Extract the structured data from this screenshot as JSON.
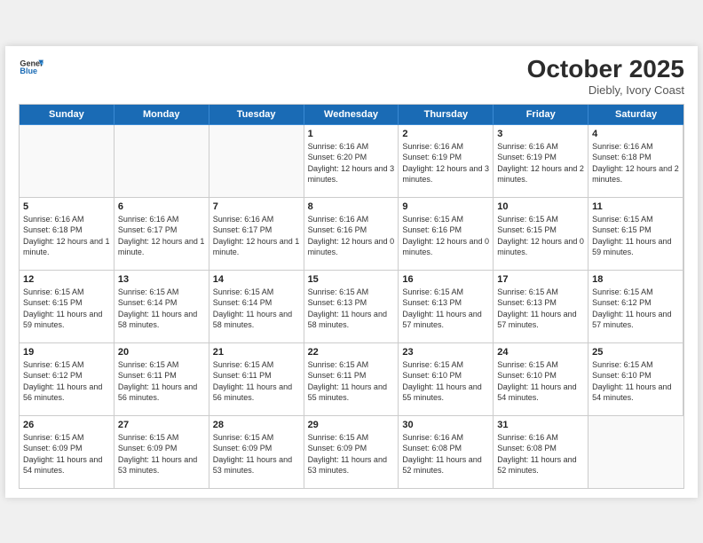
{
  "header": {
    "logo_line1": "General",
    "logo_line2": "Blue",
    "month": "October 2025",
    "location": "Diebly, Ivory Coast"
  },
  "weekdays": [
    "Sunday",
    "Monday",
    "Tuesday",
    "Wednesday",
    "Thursday",
    "Friday",
    "Saturday"
  ],
  "weeks": [
    [
      {
        "num": "",
        "info": ""
      },
      {
        "num": "",
        "info": ""
      },
      {
        "num": "",
        "info": ""
      },
      {
        "num": "1",
        "info": "Sunrise: 6:16 AM\nSunset: 6:20 PM\nDaylight: 12 hours and 3 minutes."
      },
      {
        "num": "2",
        "info": "Sunrise: 6:16 AM\nSunset: 6:19 PM\nDaylight: 12 hours and 3 minutes."
      },
      {
        "num": "3",
        "info": "Sunrise: 6:16 AM\nSunset: 6:19 PM\nDaylight: 12 hours and 2 minutes."
      },
      {
        "num": "4",
        "info": "Sunrise: 6:16 AM\nSunset: 6:18 PM\nDaylight: 12 hours and 2 minutes."
      }
    ],
    [
      {
        "num": "5",
        "info": "Sunrise: 6:16 AM\nSunset: 6:18 PM\nDaylight: 12 hours and 1 minute."
      },
      {
        "num": "6",
        "info": "Sunrise: 6:16 AM\nSunset: 6:17 PM\nDaylight: 12 hours and 1 minute."
      },
      {
        "num": "7",
        "info": "Sunrise: 6:16 AM\nSunset: 6:17 PM\nDaylight: 12 hours and 1 minute."
      },
      {
        "num": "8",
        "info": "Sunrise: 6:16 AM\nSunset: 6:16 PM\nDaylight: 12 hours and 0 minutes."
      },
      {
        "num": "9",
        "info": "Sunrise: 6:15 AM\nSunset: 6:16 PM\nDaylight: 12 hours and 0 minutes."
      },
      {
        "num": "10",
        "info": "Sunrise: 6:15 AM\nSunset: 6:15 PM\nDaylight: 12 hours and 0 minutes."
      },
      {
        "num": "11",
        "info": "Sunrise: 6:15 AM\nSunset: 6:15 PM\nDaylight: 11 hours and 59 minutes."
      }
    ],
    [
      {
        "num": "12",
        "info": "Sunrise: 6:15 AM\nSunset: 6:15 PM\nDaylight: 11 hours and 59 minutes."
      },
      {
        "num": "13",
        "info": "Sunrise: 6:15 AM\nSunset: 6:14 PM\nDaylight: 11 hours and 58 minutes."
      },
      {
        "num": "14",
        "info": "Sunrise: 6:15 AM\nSunset: 6:14 PM\nDaylight: 11 hours and 58 minutes."
      },
      {
        "num": "15",
        "info": "Sunrise: 6:15 AM\nSunset: 6:13 PM\nDaylight: 11 hours and 58 minutes."
      },
      {
        "num": "16",
        "info": "Sunrise: 6:15 AM\nSunset: 6:13 PM\nDaylight: 11 hours and 57 minutes."
      },
      {
        "num": "17",
        "info": "Sunrise: 6:15 AM\nSunset: 6:13 PM\nDaylight: 11 hours and 57 minutes."
      },
      {
        "num": "18",
        "info": "Sunrise: 6:15 AM\nSunset: 6:12 PM\nDaylight: 11 hours and 57 minutes."
      }
    ],
    [
      {
        "num": "19",
        "info": "Sunrise: 6:15 AM\nSunset: 6:12 PM\nDaylight: 11 hours and 56 minutes."
      },
      {
        "num": "20",
        "info": "Sunrise: 6:15 AM\nSunset: 6:11 PM\nDaylight: 11 hours and 56 minutes."
      },
      {
        "num": "21",
        "info": "Sunrise: 6:15 AM\nSunset: 6:11 PM\nDaylight: 11 hours and 56 minutes."
      },
      {
        "num": "22",
        "info": "Sunrise: 6:15 AM\nSunset: 6:11 PM\nDaylight: 11 hours and 55 minutes."
      },
      {
        "num": "23",
        "info": "Sunrise: 6:15 AM\nSunset: 6:10 PM\nDaylight: 11 hours and 55 minutes."
      },
      {
        "num": "24",
        "info": "Sunrise: 6:15 AM\nSunset: 6:10 PM\nDaylight: 11 hours and 54 minutes."
      },
      {
        "num": "25",
        "info": "Sunrise: 6:15 AM\nSunset: 6:10 PM\nDaylight: 11 hours and 54 minutes."
      }
    ],
    [
      {
        "num": "26",
        "info": "Sunrise: 6:15 AM\nSunset: 6:09 PM\nDaylight: 11 hours and 54 minutes."
      },
      {
        "num": "27",
        "info": "Sunrise: 6:15 AM\nSunset: 6:09 PM\nDaylight: 11 hours and 53 minutes."
      },
      {
        "num": "28",
        "info": "Sunrise: 6:15 AM\nSunset: 6:09 PM\nDaylight: 11 hours and 53 minutes."
      },
      {
        "num": "29",
        "info": "Sunrise: 6:15 AM\nSunset: 6:09 PM\nDaylight: 11 hours and 53 minutes."
      },
      {
        "num": "30",
        "info": "Sunrise: 6:16 AM\nSunset: 6:08 PM\nDaylight: 11 hours and 52 minutes."
      },
      {
        "num": "31",
        "info": "Sunrise: 6:16 AM\nSunset: 6:08 PM\nDaylight: 11 hours and 52 minutes."
      },
      {
        "num": "",
        "info": ""
      }
    ]
  ]
}
